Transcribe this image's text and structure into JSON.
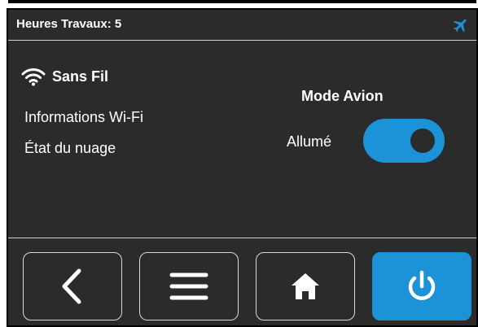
{
  "header": {
    "title": "Heures Travaux: 5",
    "icon": "airplane-icon"
  },
  "wifi": {
    "label": "Sans Fil",
    "icon": "wifi-icon"
  },
  "menu": {
    "items": [
      "Informations Wi-Fi",
      "État du nuage"
    ]
  },
  "airplane_mode": {
    "title": "Mode Avion",
    "state_label": "Allumé",
    "enabled": true
  },
  "nav": {
    "buttons": [
      "back",
      "menu",
      "home",
      "power"
    ]
  },
  "colors": {
    "accent": "#1b93d6",
    "background": "#2b2b2b",
    "text": "#ffffff"
  }
}
